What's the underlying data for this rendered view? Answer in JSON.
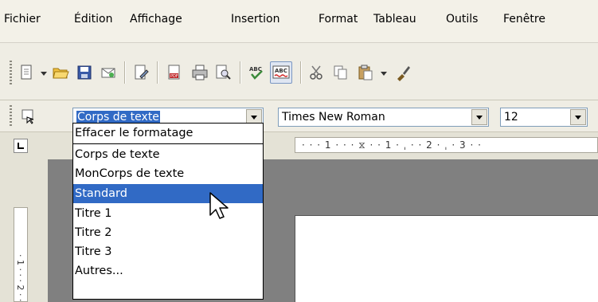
{
  "menu": [
    "Fichier",
    "Édition",
    "Affichage",
    "Insertion",
    "Format",
    "Tableau",
    "Outils",
    "Fenêtre"
  ],
  "toolbar": {
    "icons": [
      "new-document-icon",
      "open-folder-icon",
      "save-icon",
      "email-icon",
      "edit-file-icon",
      "export-pdf-icon",
      "print-icon",
      "page-preview-icon",
      "spellcheck-icon",
      "autospellcheck-icon",
      "cut-icon",
      "copy-icon",
      "paste-icon",
      "format-paintbrush-icon"
    ]
  },
  "format_toolbar": {
    "style_value": "Corps de texte",
    "font_value": "Times New Roman",
    "size_value": "12"
  },
  "style_dropdown": {
    "items": [
      "Effacer le formatage",
      "Corps de texte",
      "MonCorps de texte",
      "Standard",
      "Titre 1",
      "Titre 2",
      "Titre 3",
      "Autres..."
    ],
    "highlighted": "Standard"
  },
  "ruler": {
    "horizontal": "· · · 1 · · · ⧖ · · 1 · ˌ · · 2 · ˌ · 3 · ·",
    "vertical": "· 1 · · · 2 · ·"
  },
  "colors": {
    "highlight": "#316ac5",
    "toolbar_bg": "#efede4",
    "workspace": "#808080"
  }
}
